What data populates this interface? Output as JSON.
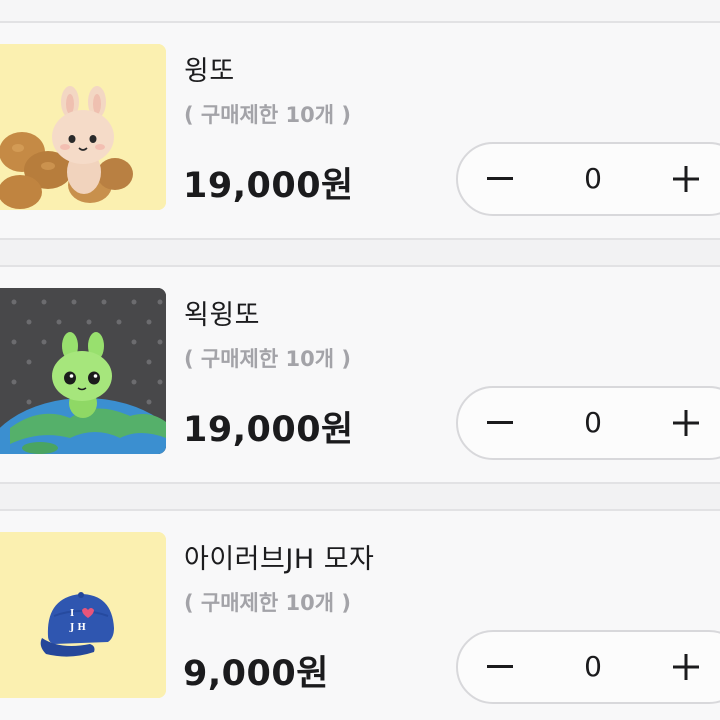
{
  "products": [
    {
      "name": "윙또",
      "limit": "( 구매제한 10개 )",
      "price": "19,000원",
      "quantity": "0",
      "image": "beige-bunny-with-potatoes",
      "bg_color": "#fbf0b0"
    },
    {
      "name": "왹윙또",
      "limit": "( 구매제한 10개 )",
      "price": "19,000원",
      "quantity": "0",
      "image": "green-bunny-on-earth",
      "bg_color": "#48484a"
    },
    {
      "name": "아이러브JH 모자",
      "limit": "( 구매제한 10개 )",
      "price": "9,000원",
      "quantity": "0",
      "image": "blue-i-love-jh-cap",
      "bg_color": "#fbf0b0"
    }
  ],
  "icons": {
    "minus": "minus-icon",
    "plus": "plus-icon"
  }
}
